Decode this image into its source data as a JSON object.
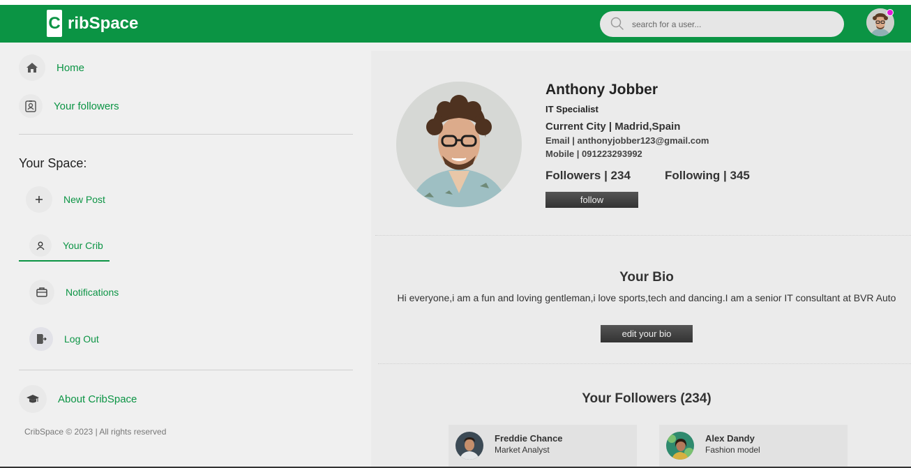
{
  "brand": {
    "logo_letter": "C",
    "logo_text": "ribSpace"
  },
  "colors": {
    "brand_green": "#0b9444",
    "notification_dot": "#e01ad6"
  },
  "header": {
    "search_placeholder": "search for a user...",
    "search_icon": "search-icon"
  },
  "sidebar": {
    "primary": [
      {
        "label": "Home",
        "icon": "home-icon"
      },
      {
        "label": "Your followers",
        "icon": "contact-badge-icon"
      }
    ],
    "space_title": "Your Space:",
    "space_items": [
      {
        "label": "New Post",
        "icon": "plus-icon"
      },
      {
        "label": "Your Crib",
        "icon": "user-icon",
        "active": true
      },
      {
        "label": "Notifications",
        "icon": "briefcase-icon"
      },
      {
        "label": "Log Out",
        "icon": "logout-door-icon"
      }
    ],
    "about": {
      "label": "About CribSpace",
      "icon": "graduation-cap-icon"
    },
    "copyright": "CribSpace © 2023 | All rights reserved"
  },
  "profile": {
    "name": "Anthony Jobber",
    "title": "IT Specialist",
    "city": "Current City | Madrid,Spain",
    "email": "Email | anthonyjobber123@gmail.com",
    "mobile": "Mobile | 091223293992",
    "followers": "Followers | 234",
    "following": "Following | 345",
    "follow_button": "follow"
  },
  "bio": {
    "title": "Your Bio",
    "text": "Hi everyone,i am a fun and loving gentleman,i love sports,tech and dancing.I am a senior IT consultant at BVR Auto",
    "edit_button": "edit your bio"
  },
  "followers_section": {
    "title": "Your Followers (234)",
    "list": [
      {
        "name": "Freddie Chance",
        "role": "Market Analyst"
      },
      {
        "name": "Alex Dandy",
        "role": "Fashion model"
      }
    ]
  }
}
